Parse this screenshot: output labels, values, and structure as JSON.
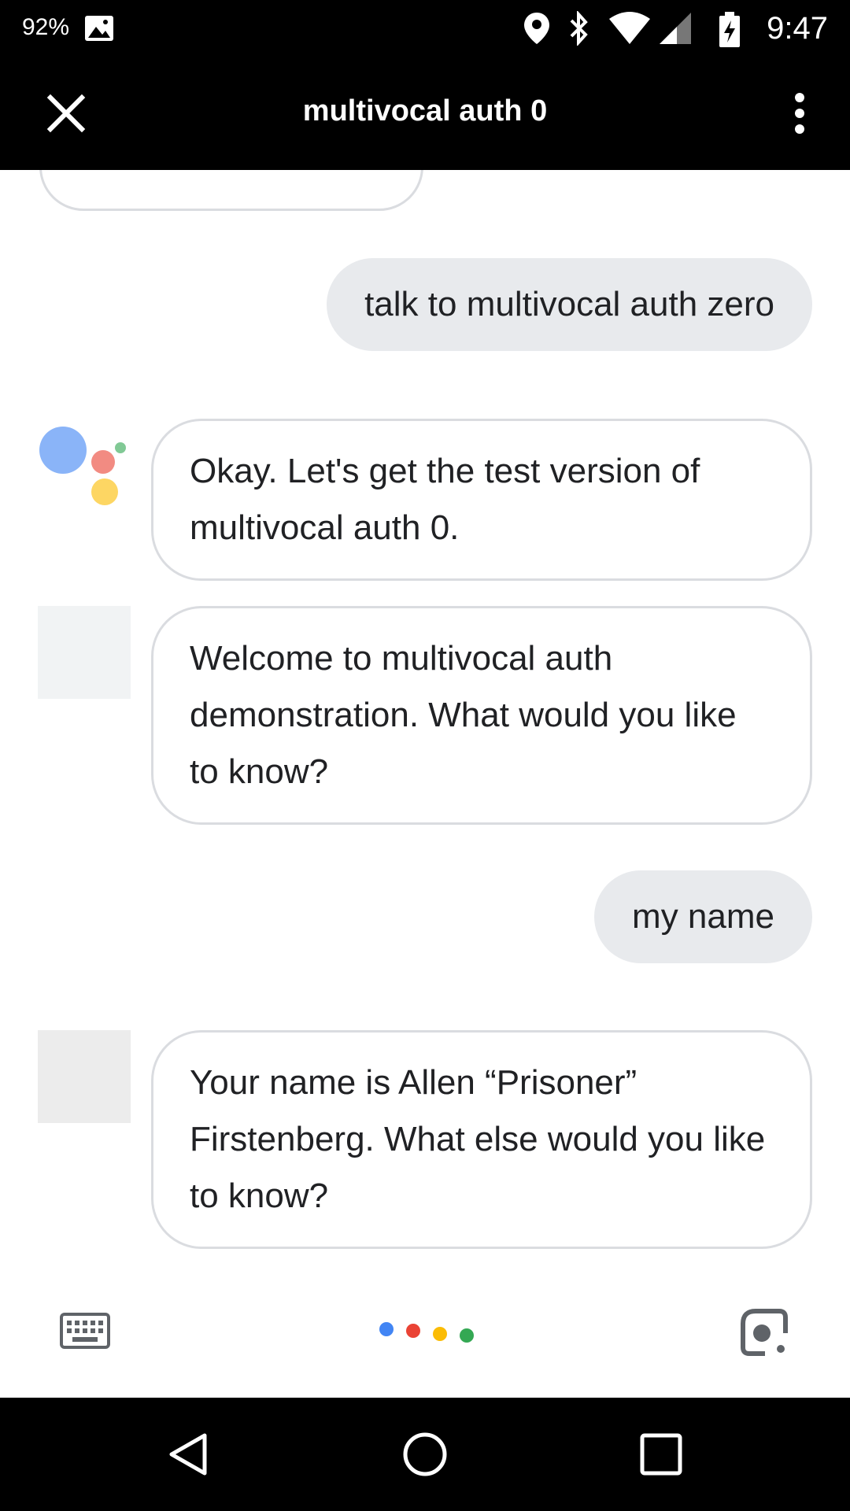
{
  "status_bar": {
    "battery_percent": "92%",
    "time": "9:47",
    "icons": [
      "image-icon",
      "location-icon",
      "bluetooth-icon",
      "wifi-icon",
      "cell-signal-icon",
      "battery-charging-icon"
    ]
  },
  "app_bar": {
    "title": "multivocal auth 0",
    "close_icon": "close-icon",
    "more_icon": "more-vert-icon"
  },
  "messages": [
    {
      "role": "user",
      "text": "talk to multivocal auth zero"
    },
    {
      "role": "assistant",
      "text": "Okay. Let's get the test version of multivocal auth 0."
    },
    {
      "role": "assistant",
      "text": "Welcome to multivocal auth demonstration. What would you like to know?"
    },
    {
      "role": "user",
      "text": "my name"
    },
    {
      "role": "assistant",
      "text": "Your name is Allen “Prisoner” Firstenberg. What else would you like to know?"
    }
  ],
  "bottom_bar": {
    "keyboard_icon": "keyboard-icon",
    "lens_icon": "lens-icon",
    "dot_colors": [
      "#4285f4",
      "#ea4335",
      "#fbbc05",
      "#34a853"
    ]
  },
  "assistant_logo_colors": [
    "#8ab4f8",
    "#f28b82",
    "#fdd663",
    "#81c995"
  ],
  "nav_bar": {
    "icons": [
      "back-icon",
      "home-icon",
      "recents-icon"
    ]
  }
}
